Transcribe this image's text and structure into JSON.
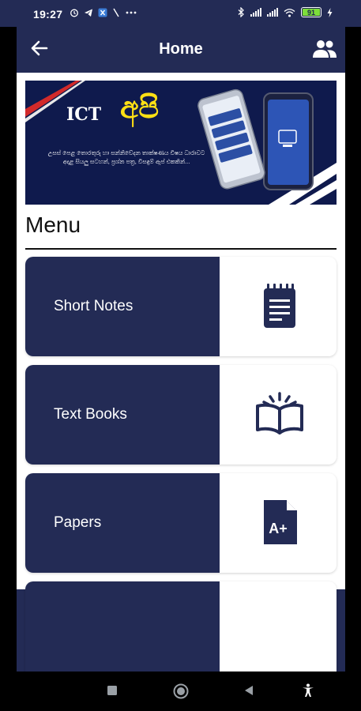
{
  "status_bar": {
    "time": "19:27",
    "battery": "91",
    "battery_level": 0.91,
    "icons_left": [
      "alarm-icon",
      "telegram-icon",
      "app-badge-icon",
      "slash-icon",
      "more-dots-icon"
    ],
    "icons_right": [
      "bluetooth-icon",
      "signal-icon",
      "signal-icon",
      "wifi-icon",
      "battery-icon",
      "charging-icon"
    ]
  },
  "appbar": {
    "title": "Home",
    "back_icon": "arrow-left-icon",
    "people_icon": "people-icon"
  },
  "banner": {
    "brand_latin": "ICT",
    "brand_sinhala": "අපි",
    "tagline": "උසස් පෙළ තොරතුරු හා සන්නිවේදන තාක්ෂණය විෂය ධාරාවට අදාළ සියලු සටහන්, ප්‍රශ්න පත්‍ර, විසඳුම් ඇප් එකකින්..."
  },
  "menu": {
    "title": "Menu",
    "items": [
      {
        "label": "Short Notes",
        "icon": "notepad-icon"
      },
      {
        "label": "Text Books",
        "icon": "open-book-icon"
      },
      {
        "label": "Papers",
        "icon": "grade-document-icon"
      }
    ]
  },
  "colors": {
    "primary": "#232b55",
    "surface": "#ffffff",
    "text": "#111111",
    "battery": "#7dde3a",
    "banner_accent": "#ffe014"
  },
  "nav": {
    "icons": [
      "square-recents-icon",
      "circle-home-icon",
      "triangle-back-icon",
      "accessibility-icon"
    ]
  }
}
